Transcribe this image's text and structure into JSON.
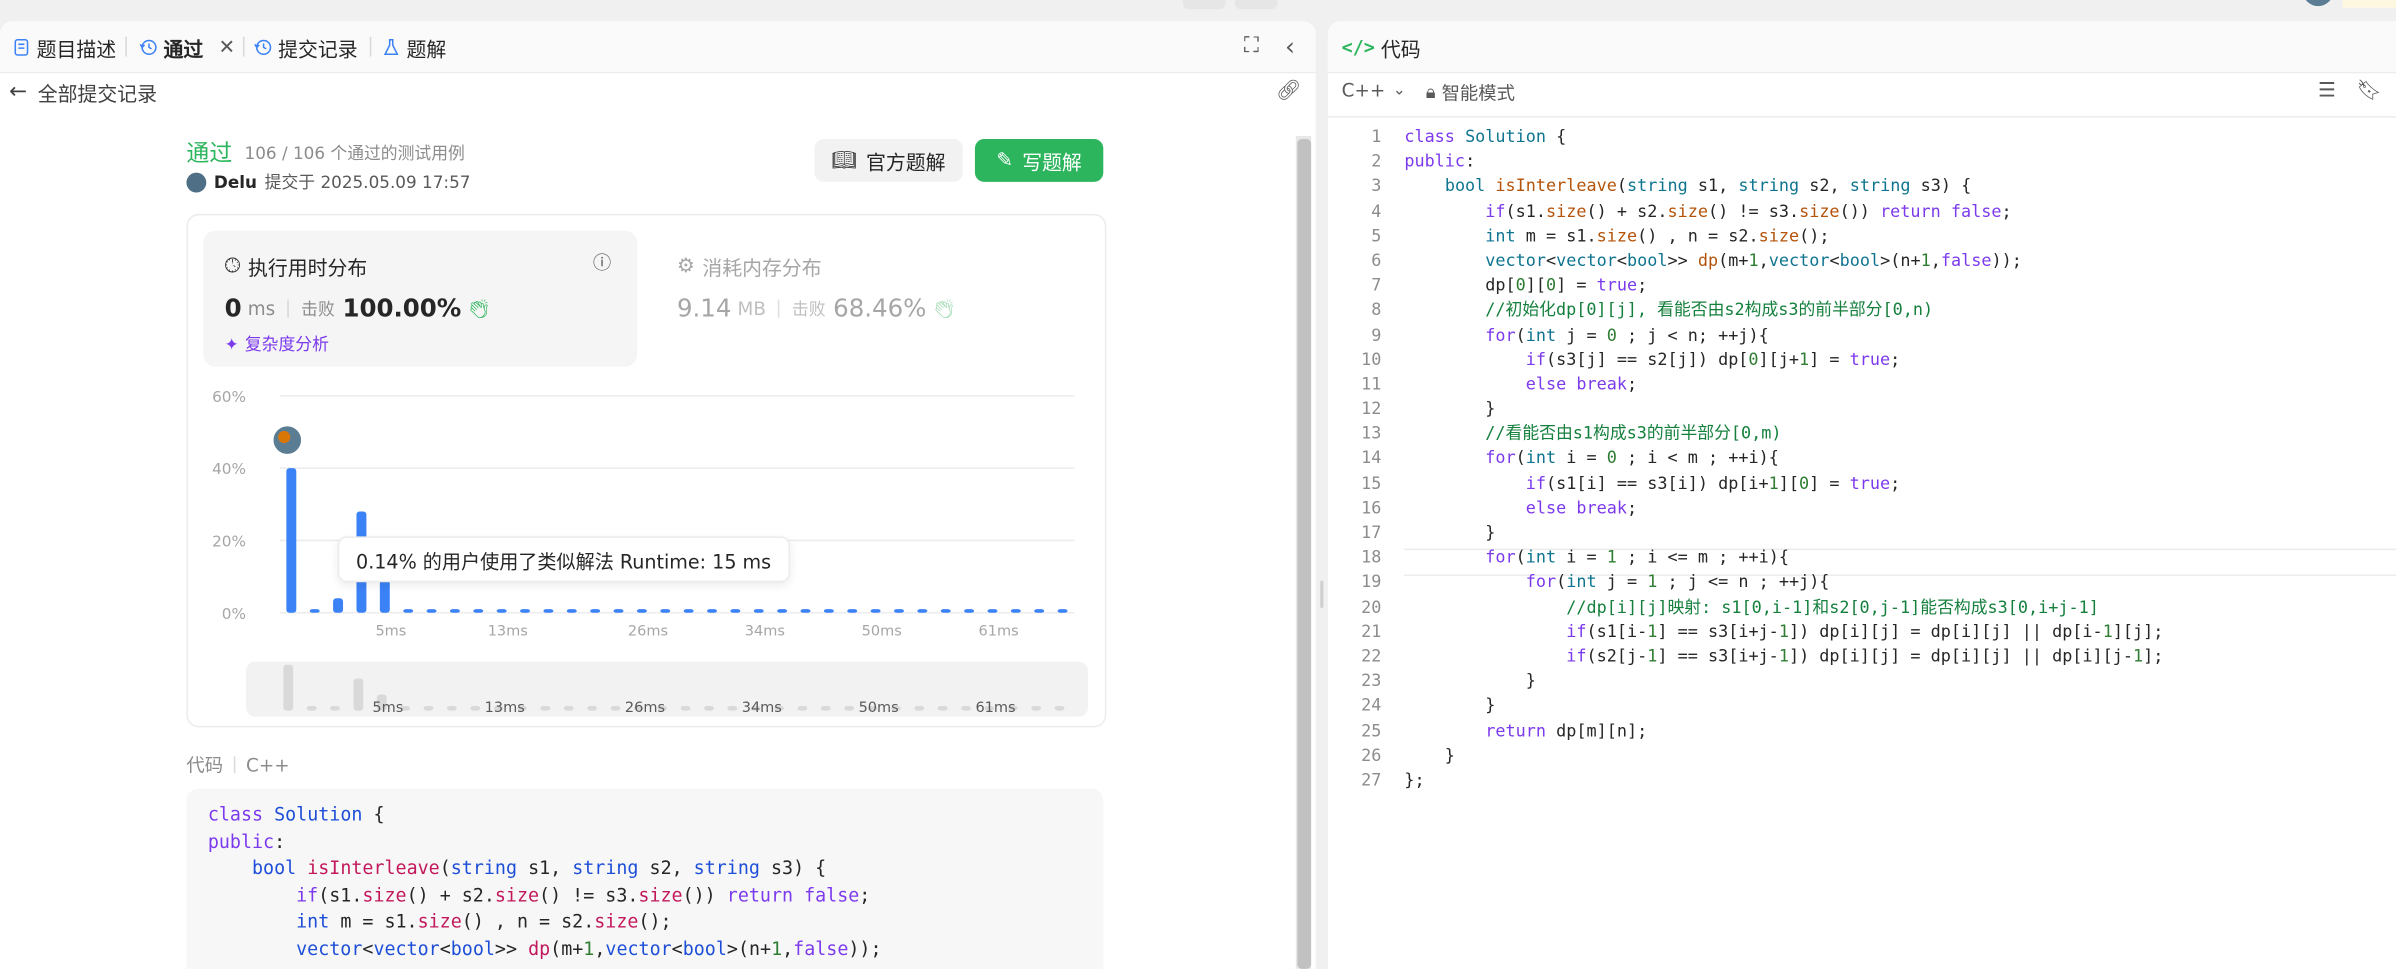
{
  "left_tabs": [
    {
      "label": "题目描述",
      "icon": "document-icon"
    },
    {
      "label": "通过",
      "icon": "history-icon",
      "closable": true,
      "active": true
    },
    {
      "label": "提交记录",
      "icon": "history-icon"
    },
    {
      "label": "题解",
      "icon": "flask-icon"
    }
  ],
  "back_label": "全部提交记录",
  "submission": {
    "status": "通过",
    "cases": "106 / 106 个通过的测试用例",
    "user": "Delu",
    "submitted_at": "提交于 2025.05.09 17:57",
    "official_btn": "官方题解",
    "write_btn": "写题解"
  },
  "runtime": {
    "title": "执行用时分布",
    "value": "0",
    "unit": "ms",
    "beats_label": "击败",
    "beats": "100.00%",
    "complexity_link": "复杂度分析"
  },
  "memory": {
    "title": "消耗内存分布",
    "value": "9.14",
    "unit": "MB",
    "beats_label": "击败",
    "beats": "68.46%"
  },
  "tooltip": "0.14% 的用户使用了类似解法 Runtime: 15 ms",
  "chart_data": {
    "type": "bar",
    "title": "",
    "xlabel": "",
    "ylabel": "",
    "ylim": [
      0,
      60
    ],
    "yticks": [
      "0%",
      "20%",
      "40%",
      "60%"
    ],
    "xticks": [
      "5ms",
      "13ms",
      "26ms",
      "34ms",
      "50ms",
      "61ms"
    ],
    "values": [
      40,
      1,
      4,
      28,
      9,
      1,
      1,
      1,
      1,
      1,
      1,
      1,
      1,
      1,
      1,
      1,
      1,
      1,
      1,
      1,
      1,
      1,
      1,
      1,
      1,
      1,
      1,
      1,
      1,
      1,
      1,
      1,
      1,
      1
    ],
    "brush_values": [
      100,
      10,
      10,
      70,
      35,
      10,
      10,
      10,
      10,
      10,
      10,
      10,
      10,
      10,
      10,
      10,
      10,
      10,
      10,
      10,
      10,
      10,
      10,
      10,
      10,
      10,
      10,
      10,
      10,
      10,
      10,
      10,
      10,
      10
    ],
    "bar_color": "#3b82f6",
    "brush_color": "#d9d9d9"
  },
  "code_section": {
    "label": "代码",
    "lang": "C++"
  },
  "right_header": {
    "title": "代码",
    "lang": "C++",
    "mode": "智能模式"
  },
  "code_lines": [
    "class Solution {",
    "public:",
    "    bool isInterleave(string s1, string s2, string s3) {",
    "        if(s1.size() + s2.size() != s3.size()) return false;",
    "        int m = s1.size() , n = s2.size();",
    "        vector<vector<bool>> dp(m+1,vector<bool>(n+1,false));",
    "        dp[0][0] = true;",
    "        //初始化dp[0][j], 看能否由s2构成s3的前半部分[0,n)",
    "        for(int j = 0 ; j < n; ++j){",
    "            if(s3[j] == s2[j]) dp[0][j+1] = true;",
    "            else break;",
    "        }",
    "        //看能否由s1构成s3的前半部分[0,m)",
    "        for(int i = 0 ; i < m ; ++i){",
    "            if(s1[i] == s3[i]) dp[i+1][0] = true;",
    "            else break;",
    "        }",
    "        for(int i = 1 ; i <= m ; ++i){",
    "            for(int j = 1 ; j <= n ; ++j){",
    "                //dp[i][j]映射: s1[0,i-1]和s2[0,j-1]能否构成s3[0,i+j-1]",
    "                if(s1[i-1] == s3[i+j-1]) dp[i][j] = dp[i][j] || dp[i-1][j];",
    "                if(s2[j-1] == s3[i+j-1]) dp[i][j] = dp[i][j] || dp[i][j-1];",
    "            }",
    "        }",
    "        return dp[m][n];",
    "    }",
    "};"
  ],
  "line_numbers": [
    "1",
    "2",
    "3",
    "4",
    "5",
    "6",
    "7",
    "8",
    "9",
    "10",
    "11",
    "12",
    "13",
    "14",
    "15",
    "16",
    "17",
    "18",
    "19",
    "20",
    "21",
    "22",
    "23",
    "24",
    "25",
    "26",
    "27"
  ]
}
